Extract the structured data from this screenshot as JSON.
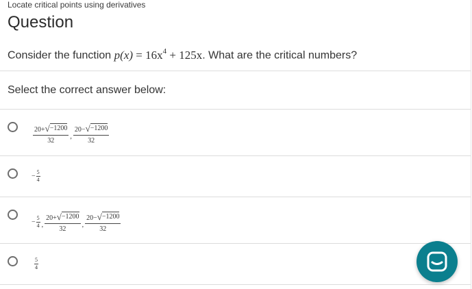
{
  "header": {
    "breadcrumb": "Locate critical points using derivatives",
    "title": "Question"
  },
  "question": {
    "text_before": "Consider the function ",
    "function_lhs": "p(x)",
    "equals": " = ",
    "term1": "16x",
    "exponent": "4",
    "plus": " + ",
    "term2": "125x",
    "text_after": ". What are the critical numbers?"
  },
  "prompt": "Select the correct answer below:",
  "choices": {
    "a": {
      "num1": "20+",
      "rad1": "−1200",
      "den1": "32",
      "sep": ",",
      "num2": "20−",
      "rad2": "−1200",
      "den2": "32"
    },
    "b": {
      "minus": "−",
      "num": "5",
      "den": "4"
    },
    "c": {
      "minus": "−",
      "num0": "5",
      "den0": "4",
      "sep0": ",",
      "num1": "20+",
      "rad1": "−1200",
      "den1": "32",
      "sep": ",",
      "num2": "20−",
      "rad2": "−1200",
      "den2": "32"
    },
    "d": {
      "num": "5",
      "den": "4"
    }
  },
  "icons": {
    "chat": "chat-bubble-icon",
    "radical": "√"
  },
  "colors": {
    "accent": "#0b7f8e",
    "radio_border": "#6d6d6d",
    "divider": "#dcdcdc"
  }
}
